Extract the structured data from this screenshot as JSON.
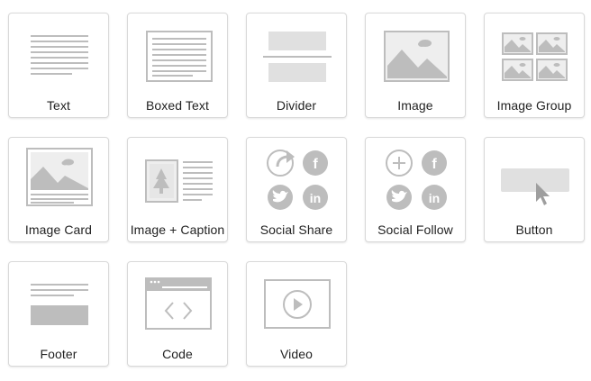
{
  "colors": {
    "icon_gray": "#bdbdbd",
    "icon_light": "#e0e0e0",
    "icon_dark": "#9e9e9e",
    "label": "#222222",
    "border": "#d9d9d9"
  },
  "blocks": [
    {
      "label": "Text",
      "icon": "text-lines-icon"
    },
    {
      "label": "Boxed Text",
      "icon": "boxed-text-icon"
    },
    {
      "label": "Divider",
      "icon": "divider-icon"
    },
    {
      "label": "Image",
      "icon": "image-icon"
    },
    {
      "label": "Image Group",
      "icon": "image-group-icon"
    },
    {
      "label": "Image Card",
      "icon": "image-card-icon"
    },
    {
      "label": "Image + Caption",
      "icon": "image-caption-icon"
    },
    {
      "label": "Social Share",
      "icon": "social-share-icon"
    },
    {
      "label": "Social Follow",
      "icon": "social-follow-icon"
    },
    {
      "label": "Button",
      "icon": "button-cursor-icon"
    },
    {
      "label": "Footer",
      "icon": "footer-icon"
    },
    {
      "label": "Code",
      "icon": "code-window-icon"
    },
    {
      "label": "Video",
      "icon": "video-play-icon"
    }
  ]
}
